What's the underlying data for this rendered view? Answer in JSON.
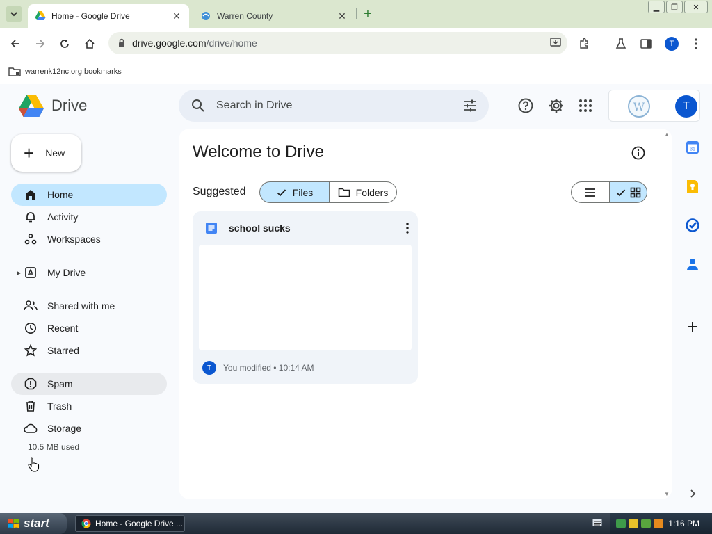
{
  "browser": {
    "tabs": [
      {
        "title": "Home - Google Drive",
        "active": true
      },
      {
        "title": "Warren County",
        "active": false
      }
    ],
    "url_domain": "drive.google.com",
    "url_path": "/drive/home",
    "profile_initial": "T",
    "bookmark_label": "warrenk12nc.org bookmarks"
  },
  "drive": {
    "logo_text": "Drive",
    "search_placeholder": "Search in Drive",
    "account_initial": "T",
    "new_label": "New",
    "nav": [
      {
        "label": "Home",
        "icon": "home-icon",
        "active": true
      },
      {
        "label": "Activity",
        "icon": "bell-icon"
      },
      {
        "label": "Workspaces",
        "icon": "workspaces-icon"
      },
      {
        "label": "My Drive",
        "icon": "my-drive-icon"
      },
      {
        "label": "Shared with me",
        "icon": "people-icon"
      },
      {
        "label": "Recent",
        "icon": "clock-icon"
      },
      {
        "label": "Starred",
        "icon": "star-icon"
      },
      {
        "label": "Spam",
        "icon": "spam-icon",
        "hover": true
      },
      {
        "label": "Trash",
        "icon": "trash-icon"
      },
      {
        "label": "Storage",
        "icon": "cloud-icon"
      }
    ],
    "storage_used": "10.5 MB used",
    "welcome_title": "Welcome to Drive",
    "suggested_label": "Suggested",
    "chip_files": "Files",
    "chip_folders": "Folders",
    "file_card": {
      "name": "school sucks",
      "meta": "You modified • 10:14 AM",
      "owner_initial": "T"
    }
  },
  "taskbar": {
    "start_label": "start",
    "task_label": "Home - Google Drive ...",
    "clock": "1:16 PM"
  },
  "colors": {
    "accent": "#0b57d0",
    "selected": "#c2e7ff",
    "tabstrip": "#dbe7cf"
  }
}
